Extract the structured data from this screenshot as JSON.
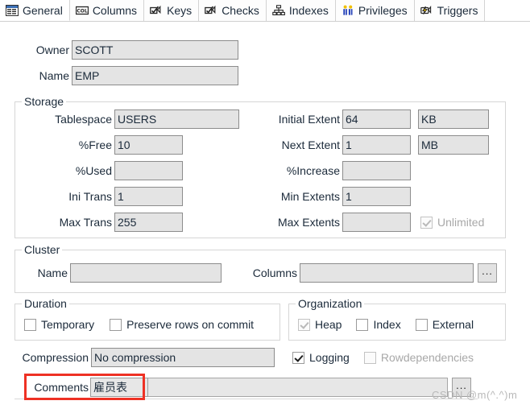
{
  "tabs": [
    {
      "label": "General",
      "icon": "table-window-icon",
      "active": true
    },
    {
      "label": "Columns",
      "icon": "column-grid-icon",
      "active": false
    },
    {
      "label": "Keys",
      "icon": "key-check-icon",
      "active": false
    },
    {
      "label": "Checks",
      "icon": "check-mark-icon",
      "active": false
    },
    {
      "label": "Indexes",
      "icon": "index-tree-icon",
      "active": false
    },
    {
      "label": "Privileges",
      "icon": "users-icon",
      "active": false
    },
    {
      "label": "Triggers",
      "icon": "trigger-bolt-icon",
      "active": false
    }
  ],
  "general": {
    "owner_label": "Owner",
    "owner_value": "SCOTT",
    "name_label": "Name",
    "name_value": "EMP"
  },
  "storage": {
    "title": "Storage",
    "tablespace_label": "Tablespace",
    "tablespace_value": "USERS",
    "pct_free_label": "%Free",
    "pct_free_value": "10",
    "pct_used_label": "%Used",
    "pct_used_value": "",
    "ini_trans_label": "Ini Trans",
    "ini_trans_value": "1",
    "max_trans_label": "Max Trans",
    "max_trans_value": "255",
    "initial_extent_label": "Initial Extent",
    "initial_extent_value": "64",
    "initial_extent_unit": "KB",
    "next_extent_label": "Next Extent",
    "next_extent_value": "1",
    "next_extent_unit": "MB",
    "pct_increase_label": "%Increase",
    "pct_increase_value": "",
    "min_extents_label": "Min Extents",
    "min_extents_value": "1",
    "max_extents_label": "Max Extents",
    "max_extents_value": "",
    "unlimited_label": "Unlimited"
  },
  "cluster": {
    "title": "Cluster",
    "name_label": "Name",
    "name_value": "",
    "columns_label": "Columns",
    "columns_value": "",
    "browse_label": "..."
  },
  "duration": {
    "title": "Duration",
    "temporary_label": "Temporary",
    "preserve_label": "Preserve rows on commit"
  },
  "organization": {
    "title": "Organization",
    "heap_label": "Heap",
    "index_label": "Index",
    "external_label": "External"
  },
  "compression": {
    "label": "Compression",
    "value": "No compression",
    "logging_label": "Logging",
    "rowdependencies_label": "Rowdependencies"
  },
  "comments": {
    "label": "Comments",
    "value": "雇员表",
    "browse_label": "..."
  },
  "watermark": {
    "text": "CSDN @m(^.^)m"
  },
  "colors": {
    "annotation": "#ee3124",
    "field_bg": "#e4e4e4",
    "field_border": "#8c8c8c",
    "group_border": "#d6d6d6",
    "text": "#1b2a3a",
    "disabled_text": "#a8a8a8",
    "watermark": "#b9b9b9"
  }
}
